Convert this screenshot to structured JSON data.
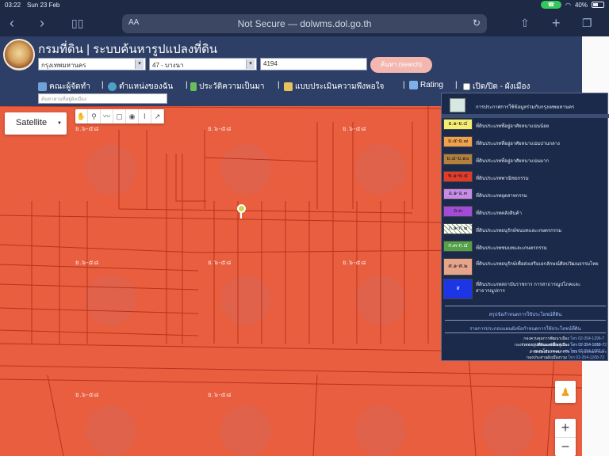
{
  "status_bar": {
    "time": "03:22",
    "date": "Sun 23 Feb",
    "battery": "40%"
  },
  "browser": {
    "aa_label": "AA",
    "url": "Not Secure — dolwms.dol.go.th"
  },
  "header": {
    "title": "กรมที่ดิน | ระบบค้นหารูปแปลงที่ดิน",
    "province_select": "กรุงเทพมหานคร",
    "district_select": "47 - บางนา",
    "parcel_value": "4194",
    "search_button": "ค้นหา (search)"
  },
  "nav": {
    "items": [
      {
        "label": "คณะผู้จัดทำ",
        "icon": "group-icon",
        "color": "#6fa3d8"
      },
      {
        "label": "ตำแหน่งของฉัน",
        "icon": "globe-icon",
        "color": "#4ea0c8"
      },
      {
        "label": "ประวัติความเป็นมา",
        "icon": "sprout-icon",
        "color": "#6bbf59"
      },
      {
        "label": "แบบประเมินความพึงพอใจ",
        "icon": "form-icon",
        "color": "#e8c25a"
      },
      {
        "label": "Rating",
        "icon": "chart-icon",
        "color": "#7db0e8"
      },
      {
        "label": "เปิด/ปิด - ผังเมือง",
        "icon": "checkbox-icon",
        "color": "#ffffff"
      }
    ],
    "search_placeholder": "ค้นหาตามที่อยู่ผังเมือง"
  },
  "map": {
    "map_type": "Satellite",
    "zone_labels": [
      "ย.๖-๕๘",
      "ย.๖-๕๘",
      "ย.๖-๕๘",
      "ย.๖-๕๘",
      "ย.๖-๕๘",
      "ย.๖-๕๘",
      "ย.๖-๕๘",
      "ย.๖-๕๘"
    ],
    "zoom_in": "+",
    "zoom_out": "−",
    "land_color": "#e85e3f"
  },
  "legend": {
    "header": "การประกาศการใช้ข้อมูลร่วมกับกรุงเทพมหานคร",
    "items": [
      {
        "code": "ย.๑-ย.๔",
        "text": "ที่ดินประเภทที่อยู่อาศัยหนาแน่นน้อย",
        "color": "#f3ee71"
      },
      {
        "code": "ย.๕-ย.๗",
        "text": "ที่ดินประเภทที่อยู่อาศัยหนาแน่นปานกลาง",
        "color": "#f1a14a"
      },
      {
        "code": "ย.๘-ย.๑๐",
        "text": "ที่ดินประเภทที่อยู่อาศัยหนาแน่นมาก",
        "color": "#b4803e"
      },
      {
        "code": "พ.๑-พ.๕",
        "text": "ที่ดินประเภทพาณิชยกรรม",
        "color": "#e53a2a"
      },
      {
        "code": "อ.๑-อ.๓",
        "text": "ที่ดินประเภทอุตสาหกรรม",
        "color": "#c88ce8"
      },
      {
        "code": "อ.๓",
        "text": "ที่ดินประเภทคลังสินค้า",
        "color": "#a14bd6"
      },
      {
        "code": "ก.๑-ก.๒",
        "text": "ที่ดินประเภทอนุรักษ์ชนบทและเกษตรกรรม",
        "color": "#e7efe0"
      },
      {
        "code": "ก.๓-ก.๔",
        "text": "ที่ดินประเภทชนบทและเกษตรกรรม",
        "color": "#54a14a"
      },
      {
        "code": "ศ.๑-ศ.๒",
        "text": "ที่ดินประเภทอนุรักษ์เพื่อส่งเสริมเอกลักษณ์ศิลปวัฒนธรรมไทย",
        "color": "#e6a48a"
      },
      {
        "code": "ส",
        "text": "ที่ดินประเภทสถาบันราชการ การสาธารณูปโภคและสาธารณูปการ",
        "color": "#1c36e6"
      }
    ],
    "link1": "สรุปข้อกำหนดการใช้ประโยชน์ที่ดิน",
    "link2": "รายการประกอบแผนผังข้อกำหนดการใช้ประโยชน์ที่ดิน",
    "contacts": [
      {
        "name": "กองควบคุมการพัฒนาเมือง",
        "phone": "โทร 02-354-1296-7"
      },
      {
        "name": "กองวางผังและพัฒนาเมือง",
        "phone": "โทร 02-354-1016-7"
      },
      {
        "name": "กองนโยบายและแผน",
        "phone": "โทร 02-354-1062-6"
      },
      {
        "name": "กองประสานผังเมืองรวม",
        "phone": "โทร 02-354-1268-72"
      },
      {
        "name": "กองจัดการรูปที่ดินและฟื้นฟูเมือง",
        "phone": "โทร 02-354-1268-72"
      },
      {
        "name": "สำนักผังเมือง กทม.",
        "phone": "หรือ 165 กรุงเทพมหานคร"
      }
    ]
  }
}
